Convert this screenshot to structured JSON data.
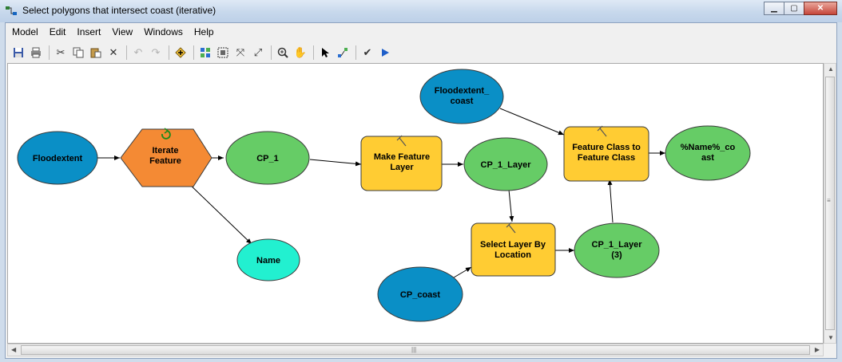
{
  "window": {
    "title": "Select polygons that intersect coast (iterative)",
    "minimize": "▁",
    "maximize": "▢",
    "close": "✕"
  },
  "menu": [
    "Model",
    "Edit",
    "Insert",
    "View",
    "Windows",
    "Help"
  ],
  "toolbar": [
    "save-icon",
    "print-icon",
    "cut-icon",
    "copy-icon",
    "paste-icon",
    "delete-icon",
    "undo-icon",
    "redo-icon",
    "add-data-icon",
    "auto-layout-icon",
    "full-extent-icon",
    "fixed-zoom-out-icon",
    "zoom-in-icon",
    "pan-icon",
    "select-icon",
    "connect-icon",
    "validate-icon",
    "run-icon"
  ],
  "colors": {
    "data_blue": "#0a8fc6",
    "derived_green": "#66cc66",
    "tool_yellow": "#ffcc33",
    "iterator_orange": "#f48a34",
    "variable_cyan": "#22f0d0"
  },
  "nodes": {
    "floodextent": {
      "lines": [
        "Floodextent"
      ]
    },
    "iterate": {
      "lines": [
        "Iterate",
        "Feature"
      ]
    },
    "cp1": {
      "lines": [
        "CP_1"
      ]
    },
    "name": {
      "lines": [
        "Name"
      ]
    },
    "make_layer": {
      "lines": [
        "Make Feature",
        "Layer"
      ]
    },
    "cp1_layer": {
      "lines": [
        "CP_1_Layer"
      ]
    },
    "flood_coast": {
      "lines": [
        "Floodextent_",
        "coast"
      ]
    },
    "fc_to_fc": {
      "lines": [
        "Feature Class to",
        "Feature Class"
      ]
    },
    "name_coast": {
      "lines": [
        "%Name%_co",
        "ast"
      ]
    },
    "select_loc": {
      "lines": [
        "Select Layer By",
        "Location"
      ]
    },
    "cp1_layer3": {
      "lines": [
        "CP_1_Layer",
        "(3)"
      ]
    },
    "cp_coast": {
      "lines": [
        "CP_coast"
      ]
    }
  },
  "scroll": {
    "grip": "|||"
  }
}
